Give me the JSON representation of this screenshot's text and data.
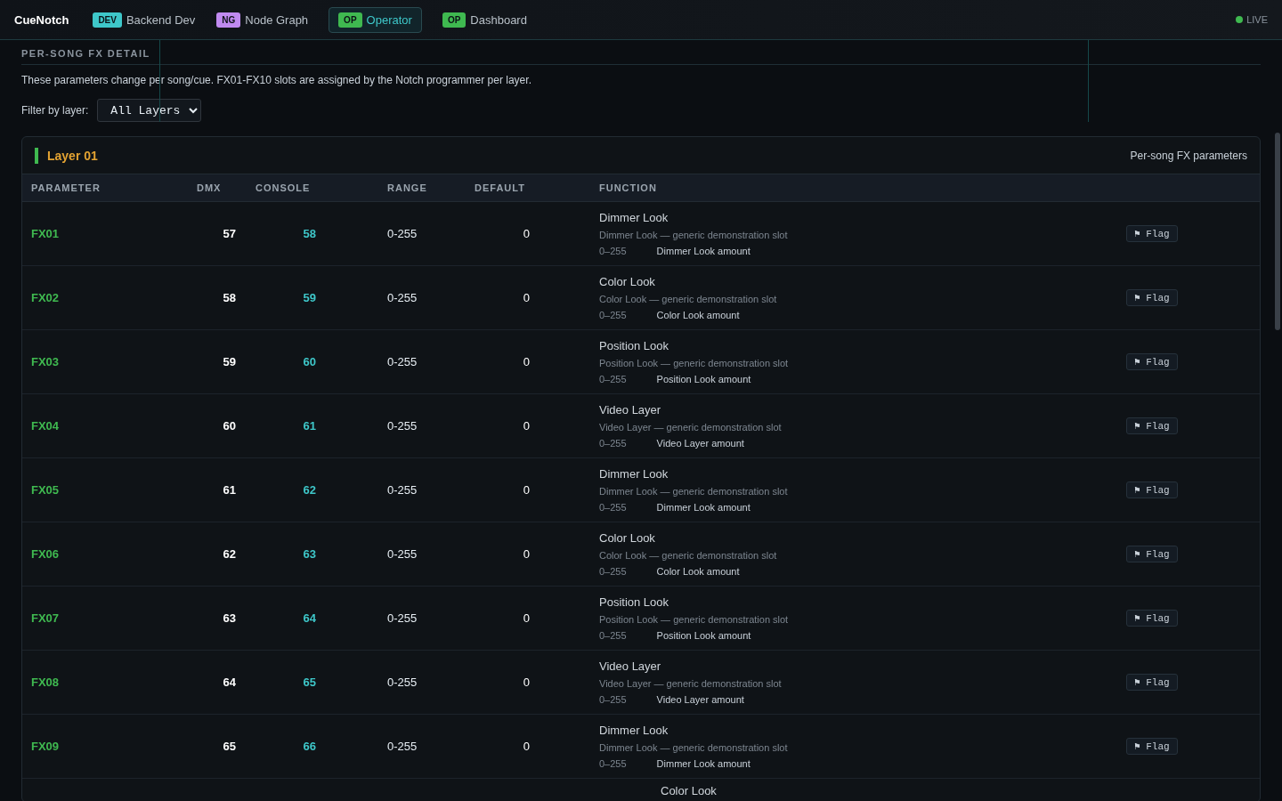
{
  "app": {
    "name": "CueNotch",
    "live": "LIVE"
  },
  "nav": [
    {
      "badge": "DEV",
      "label": "Backend Dev",
      "color": "#3ec7c9",
      "selected": false
    },
    {
      "badge": "NG",
      "label": "Node Graph",
      "color": "#c08af0",
      "selected": false
    },
    {
      "badge": "OP",
      "label": "Operator",
      "color": "#3fb950",
      "selected": true
    },
    {
      "badge": "OP",
      "label": "Dashboard",
      "color": "#3fb950",
      "selected": false
    }
  ],
  "section": {
    "title": "PER-SONG FX DETAIL",
    "description": "These parameters change per song/cue. FX01-FX10 slots are assigned by the Notch programmer per layer.",
    "filter_label": "Filter by layer:",
    "filter_value": "All Layers"
  },
  "layer": {
    "title": "Layer 01",
    "subtitle": "Per-song FX parameters",
    "columns": [
      "PARAMETER",
      "DMX",
      "CONSOLE",
      "RANGE",
      "DEFAULT",
      "FUNCTION"
    ],
    "rows": [
      {
        "parameter": "FX01",
        "dmx": "57",
        "console": "58",
        "range": "0-255",
        "default": "0",
        "function": "Dimmer Look",
        "description": "Dimmer Look — generic demonstration slot",
        "sub_range": "0–255",
        "sub_label": "Dimmer Look amount",
        "action": "⚑ Flag"
      },
      {
        "parameter": "FX02",
        "dmx": "58",
        "console": "59",
        "range": "0-255",
        "default": "0",
        "function": "Color Look",
        "description": "Color Look — generic demonstration slot",
        "sub_range": "0–255",
        "sub_label": "Color Look amount",
        "action": "⚑ Flag"
      },
      {
        "parameter": "FX03",
        "dmx": "59",
        "console": "60",
        "range": "0-255",
        "default": "0",
        "function": "Position Look",
        "description": "Position Look — generic demonstration slot",
        "sub_range": "0–255",
        "sub_label": "Position Look amount",
        "action": "⚑ Flag"
      },
      {
        "parameter": "FX04",
        "dmx": "60",
        "console": "61",
        "range": "0-255",
        "default": "0",
        "function": "Video Layer",
        "description": "Video Layer — generic demonstration slot",
        "sub_range": "0–255",
        "sub_label": "Video Layer amount",
        "action": "⚑ Flag"
      },
      {
        "parameter": "FX05",
        "dmx": "61",
        "console": "62",
        "range": "0-255",
        "default": "0",
        "function": "Dimmer Look",
        "description": "Dimmer Look — generic demonstration slot",
        "sub_range": "0–255",
        "sub_label": "Dimmer Look amount",
        "action": "⚑ Flag"
      },
      {
        "parameter": "FX06",
        "dmx": "62",
        "console": "63",
        "range": "0-255",
        "default": "0",
        "function": "Color Look",
        "description": "Color Look — generic demonstration slot",
        "sub_range": "0–255",
        "sub_label": "Color Look amount",
        "action": "⚑ Flag"
      },
      {
        "parameter": "FX07",
        "dmx": "63",
        "console": "64",
        "range": "0-255",
        "default": "0",
        "function": "Position Look",
        "description": "Position Look — generic demonstration slot",
        "sub_range": "0–255",
        "sub_label": "Position Look amount",
        "action": "⚑ Flag"
      },
      {
        "parameter": "FX08",
        "dmx": "64",
        "console": "65",
        "range": "0-255",
        "default": "0",
        "function": "Video Layer",
        "description": "Video Layer — generic demonstration slot",
        "sub_range": "0–255",
        "sub_label": "Video Layer amount",
        "action": "⚑ Flag"
      },
      {
        "parameter": "FX09",
        "dmx": "65",
        "console": "66",
        "range": "0-255",
        "default": "0",
        "function": "Dimmer Look",
        "description": "Dimmer Look — generic demonstration slot",
        "sub_range": "0–255",
        "sub_label": "Dimmer Look amount",
        "action": "⚑ Flag"
      },
      {
        "function": "Color Look"
      }
    ]
  }
}
